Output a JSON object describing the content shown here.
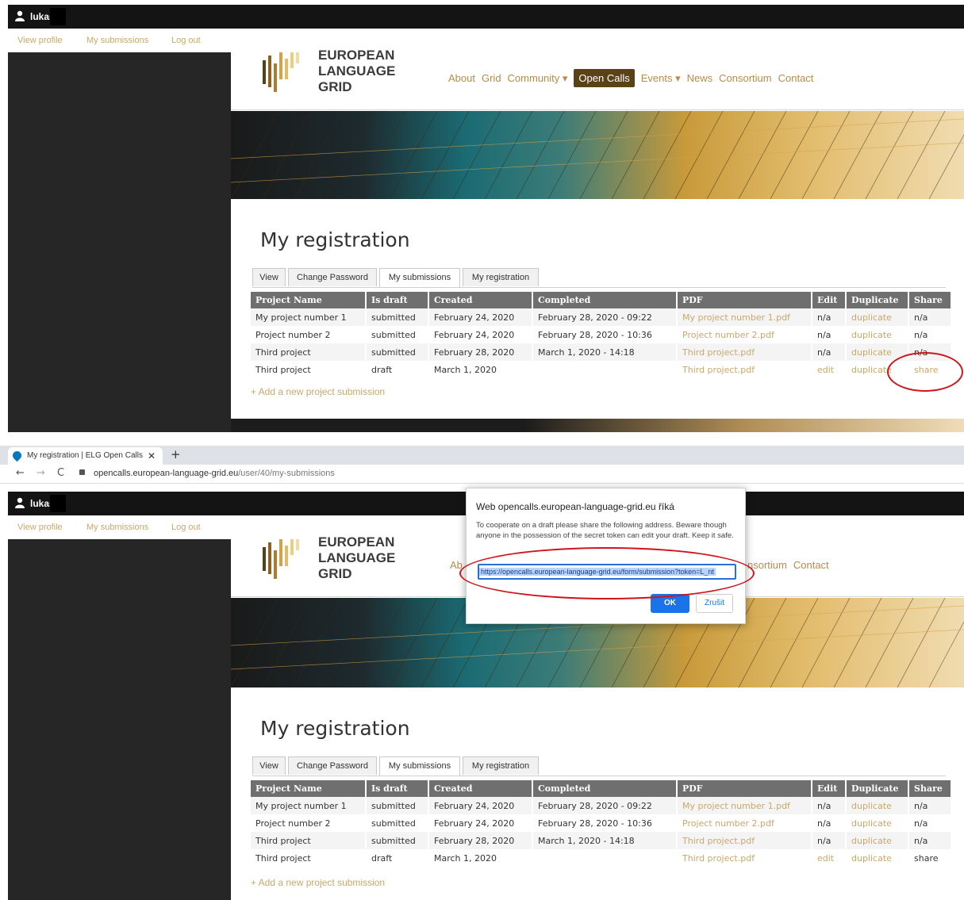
{
  "site": {
    "user_name": "lukas",
    "subnav": [
      "View profile",
      "My submissions",
      "Log out"
    ],
    "logo_lines": [
      "EUROPEAN",
      "LANGUAGE",
      "GRID"
    ],
    "nav": [
      {
        "label": "About"
      },
      {
        "label": "Grid"
      },
      {
        "label": "Community ▾"
      },
      {
        "label": "Open Calls",
        "active": true
      },
      {
        "label": "Events ▾"
      },
      {
        "label": "News"
      },
      {
        "label": "Consortium"
      },
      {
        "label": "Contact"
      }
    ],
    "nav_partial": [
      "Ab",
      "nsortium",
      "Contact"
    ]
  },
  "page": {
    "title": "My registration",
    "tabs": [
      "View",
      "Change Password",
      "My submissions",
      "My registration"
    ],
    "table_headers": [
      "Project Name",
      "Is draft",
      "Created",
      "Completed",
      "PDF",
      "Edit",
      "Duplicate",
      "Share"
    ],
    "rows": [
      {
        "name": "My project number 1",
        "draft": "submitted",
        "created": "February 24, 2020",
        "completed": "February 28, 2020 - 09:22",
        "pdf": "My project number 1.pdf",
        "edit": "n/a",
        "duplicate": "duplicate",
        "share": "n/a"
      },
      {
        "name": "Project number 2",
        "draft": "submitted",
        "created": "February 24, 2020",
        "completed": "February 28, 2020 - 10:36",
        "pdf": "Project number 2.pdf",
        "edit": "n/a",
        "duplicate": "duplicate",
        "share": "n/a"
      },
      {
        "name": "Third project",
        "draft": "submitted",
        "created": "February 28, 2020",
        "completed": "March 1, 2020 - 14:18",
        "pdf": "Third project.pdf",
        "edit": "n/a",
        "duplicate": "duplicate",
        "share": "n/a"
      },
      {
        "name": "Third project",
        "draft": "draft",
        "created": "March 1, 2020",
        "completed": "",
        "pdf": "Third project.pdf",
        "edit": "edit",
        "duplicate": "duplicate",
        "share": "share"
      }
    ],
    "add_link": "+ Add a new project submission"
  },
  "browser": {
    "tab_title": "My registration | ELG Open Calls",
    "url_host": "opencalls.european-language-grid.eu",
    "url_path": "/user/40/my-submissions"
  },
  "dialog": {
    "title": "Web opencalls.european-language-grid.eu říká",
    "message": "To cooperate on a draft please share the following address. Beware though anyone in the possession of the secret token can edit your draft. Keep it safe.",
    "input_value": "https://opencalls.european-language-grid.eu/form/submission?token=L_nt",
    "ok": "OK",
    "cancel": "Zrušit"
  },
  "colors": {
    "accent_gold": "#c8a86a",
    "active_nav_bg": "#5a4217",
    "highlight_red": "#d0141c",
    "dialog_blue": "#1a73e8"
  }
}
